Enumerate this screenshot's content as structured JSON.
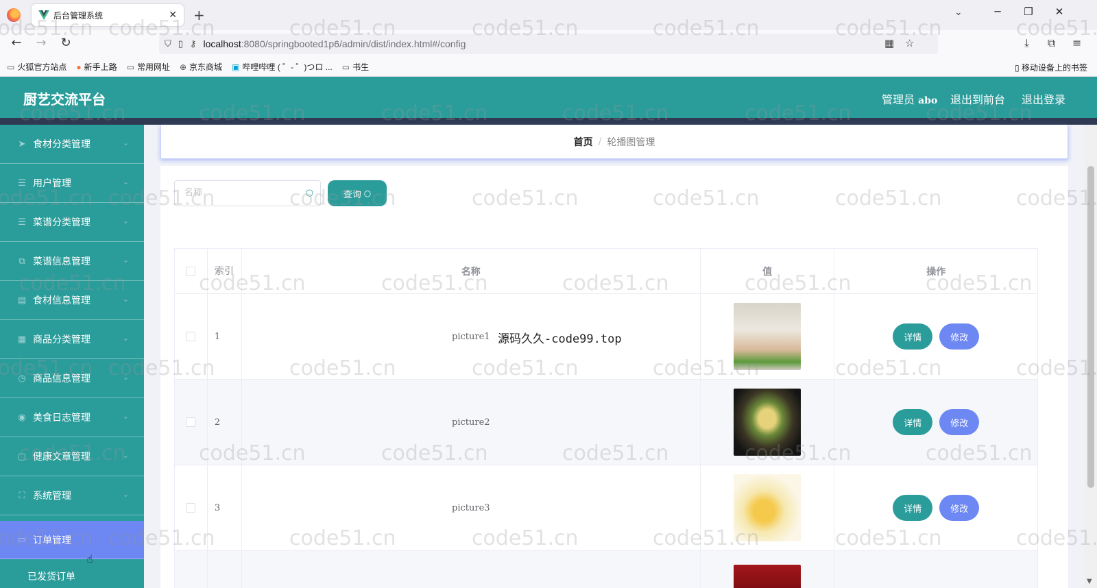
{
  "browser": {
    "tab_title": "后台管理系统",
    "url_host": "localhost",
    "url_path": ":8080/springbooted1p6/admin/dist/index.html#/config",
    "bookmarks": [
      "火狐官方站点",
      "新手上路",
      "常用网址",
      "京东商城",
      "哔哩哔哩 ( ゜- ゜)つロ ...",
      "书生"
    ],
    "mobile_bookmarks": "移动设备上的书签"
  },
  "header": {
    "brand": "厨艺交流平台",
    "role_label": "管理员",
    "username": "abo",
    "back_front": "退出到前台",
    "logout": "退出登录"
  },
  "sidebar": {
    "items": [
      {
        "label": "食材分类管理",
        "icon": "paper-plane-icon"
      },
      {
        "label": "用户管理",
        "icon": "list-icon"
      },
      {
        "label": "菜谱分类管理",
        "icon": "list-icon"
      },
      {
        "label": "菜谱信息管理",
        "icon": "copy-icon"
      },
      {
        "label": "食材信息管理",
        "icon": "trash-icon"
      },
      {
        "label": "商品分类管理",
        "icon": "box-icon"
      },
      {
        "label": "商品信息管理",
        "icon": "clock-icon"
      },
      {
        "label": "美食日志管理",
        "icon": "bulb-icon"
      },
      {
        "label": "健康文章管理",
        "icon": "document-icon"
      },
      {
        "label": "系统管理",
        "icon": "frame-icon"
      }
    ],
    "active_item": "订单管理",
    "sub_item": "已发货订单"
  },
  "breadcrumb": {
    "home": "首页",
    "separator": "/",
    "current": "轮播图管理"
  },
  "search": {
    "placeholder": "名称",
    "button_label": "查询"
  },
  "table": {
    "headers": {
      "index": "索引",
      "name": "名称",
      "value": "值",
      "ops": "操作"
    },
    "rows": [
      {
        "index": "1",
        "name": "picture1"
      },
      {
        "index": "2",
        "name": "picture2"
      },
      {
        "index": "3",
        "name": "picture3"
      }
    ],
    "detail_label": "详情",
    "edit_label": "修改"
  },
  "overlay_text": "源码久久-code99.top",
  "watermark": "code51.cn",
  "colors": {
    "primary": "#2a9d9b",
    "accent": "#6d87f3",
    "header_stripe": "#2f3a52"
  }
}
